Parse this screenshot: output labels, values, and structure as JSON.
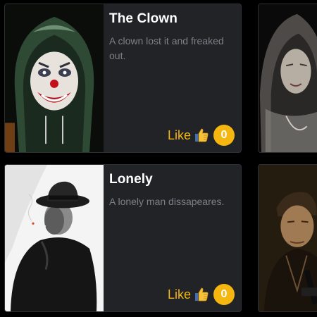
{
  "cards": [
    {
      "title": "The Clown",
      "description": "A clown lost it and freaked out.",
      "like_label": "Like",
      "like_icon": "thumbs-up-icon",
      "like_count": "0",
      "image": "clown-hoodie-portrait"
    },
    {
      "image": "hooded-woman-portrait"
    },
    {
      "title": "Lonely",
      "description": "A lonely man dissapeares.",
      "like_label": "Like",
      "like_icon": "thumbs-up-icon",
      "like_count": "0",
      "image": "man-in-fedora-smoking"
    },
    {
      "image": "man-with-gun-portrait"
    }
  ],
  "colors": {
    "background": "#000000",
    "card": "#212327",
    "accent": "#f5b610",
    "title": "#ffffff",
    "description": "#7c8087"
  }
}
